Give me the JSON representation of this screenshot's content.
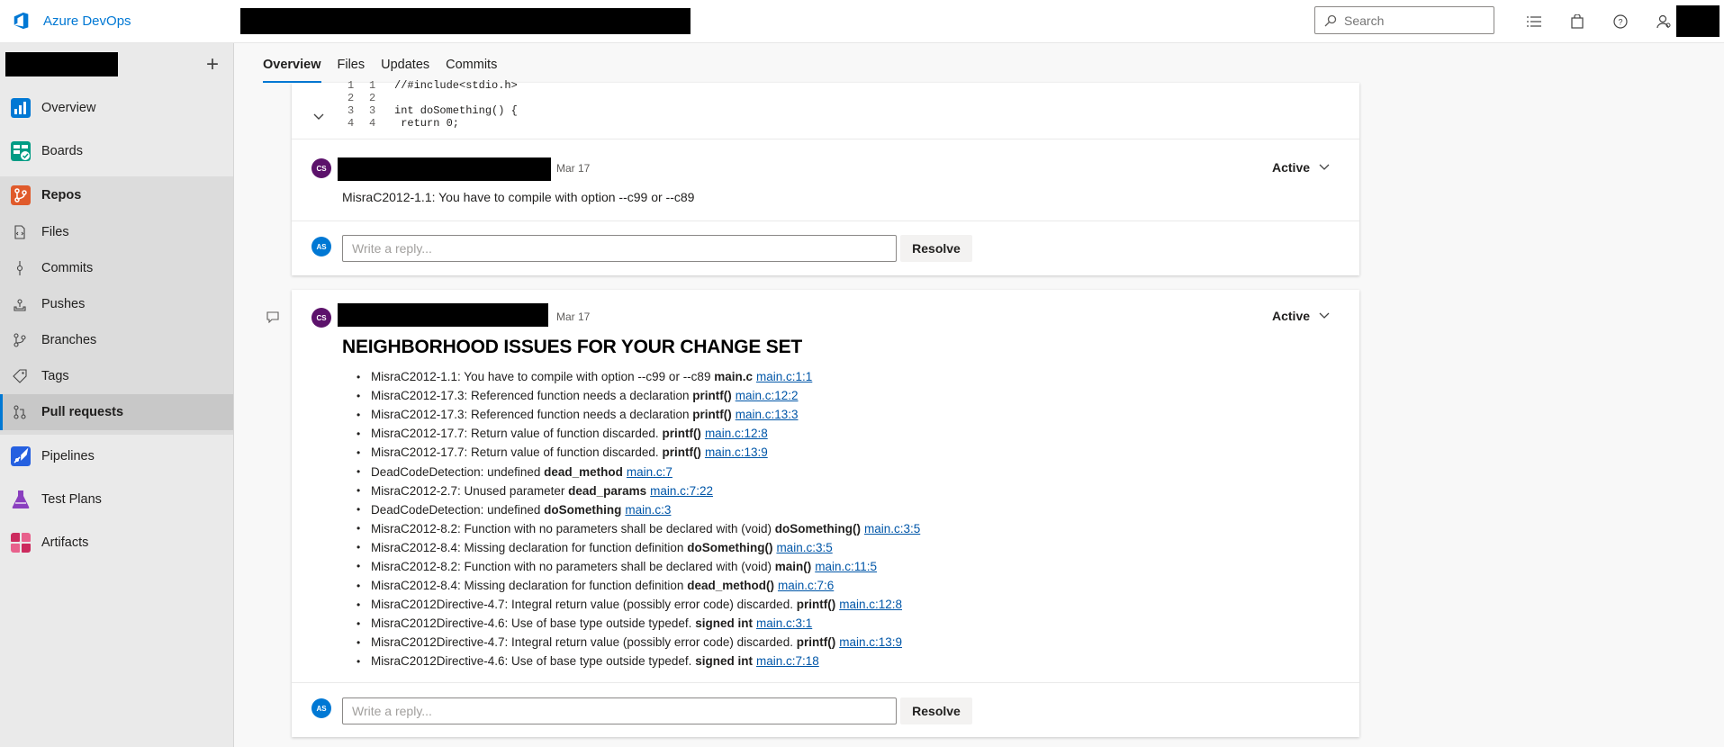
{
  "app": {
    "name": "Azure DevOps"
  },
  "search": {
    "placeholder": "Search"
  },
  "sidebar": {
    "items": [
      {
        "label": "Overview"
      },
      {
        "label": "Boards"
      },
      {
        "label": "Repos"
      },
      {
        "label": "Files"
      },
      {
        "label": "Commits"
      },
      {
        "label": "Pushes"
      },
      {
        "label": "Branches"
      },
      {
        "label": "Tags"
      },
      {
        "label": "Pull requests"
      },
      {
        "label": "Pipelines"
      },
      {
        "label": "Test Plans"
      },
      {
        "label": "Artifacts"
      }
    ]
  },
  "tabs": [
    {
      "label": "Overview"
    },
    {
      "label": "Files"
    },
    {
      "label": "Updates"
    },
    {
      "label": "Commits"
    }
  ],
  "code_snippet": {
    "lines": [
      {
        "old": "1",
        "new": "1",
        "text": "//#include<stdio.h>"
      },
      {
        "old": "2",
        "new": "2",
        "text": ""
      },
      {
        "old": "3",
        "new": "3",
        "text": "int doSomething() {"
      },
      {
        "old": "4",
        "new": "4",
        "text": "  return 0;"
      }
    ]
  },
  "thread1": {
    "avatar": "CS",
    "date": "Mar 17",
    "status": "Active",
    "text": "MisraC2012-1.1: You have to compile with option --c99 or --c89",
    "reply_avatar": "AS",
    "reply_placeholder": "Write a reply...",
    "resolve_label": "Resolve"
  },
  "thread2": {
    "avatar": "CS",
    "date": "Mar 17",
    "status": "Active",
    "title": "NEIGHBORHOOD ISSUES FOR YOUR CHANGE SET",
    "issues": [
      {
        "text": "MisraC2012-1.1: You have to compile with option --c99 or --c89",
        "code": "main.c",
        "link": "main.c:1:1"
      },
      {
        "text": "MisraC2012-17.3: Referenced function needs a declaration",
        "code": "printf()",
        "link": "main.c:12:2"
      },
      {
        "text": "MisraC2012-17.3: Referenced function needs a declaration",
        "code": "printf()",
        "link": "main.c:13:3"
      },
      {
        "text": "MisraC2012-17.7: Return value of function discarded.",
        "code": "printf()",
        "link": "main.c:12:8"
      },
      {
        "text": "MisraC2012-17.7: Return value of function discarded.",
        "code": "printf()",
        "link": "main.c:13:9"
      },
      {
        "text": "DeadCodeDetection: undefined",
        "code": "dead_method",
        "link": "main.c:7"
      },
      {
        "text": "MisraC2012-2.7: Unused parameter",
        "code": "dead_params",
        "link": "main.c:7:22"
      },
      {
        "text": "DeadCodeDetection: undefined",
        "code": "doSomething",
        "link": "main.c:3"
      },
      {
        "text": "MisraC2012-8.2: Function with no parameters shall be declared with (void)",
        "code": "doSomething()",
        "link": "main.c:3:5"
      },
      {
        "text": "MisraC2012-8.4: Missing declaration for function definition",
        "code": "doSomething()",
        "link": "main.c:3:5"
      },
      {
        "text": "MisraC2012-8.2: Function with no parameters shall be declared with (void)",
        "code": "main()",
        "link": "main.c:11:5"
      },
      {
        "text": "MisraC2012-8.4: Missing declaration for function definition",
        "code": "dead_method()",
        "link": "main.c:7:6"
      },
      {
        "text": "MisraC2012Directive-4.7: Integral return value (possibly error code) discarded.",
        "code": "printf()",
        "link": "main.c:12:8"
      },
      {
        "text": "MisraC2012Directive-4.6: Use of base type outside typedef.",
        "code": "signed int",
        "link": "main.c:3:1"
      },
      {
        "text": "MisraC2012Directive-4.7: Integral return value (possibly error code) discarded.",
        "code": "printf()",
        "link": "main.c:13:9"
      },
      {
        "text": "MisraC2012Directive-4.6: Use of base type outside typedef.",
        "code": "signed int",
        "link": "main.c:7:18"
      }
    ],
    "reply_avatar": "AS",
    "reply_placeholder": "Write a reply...",
    "resolve_label": "Resolve"
  },
  "colors": {
    "accent": "#0078d4",
    "avatar_cs": "#5c126b",
    "avatar_as": "#0078d4"
  }
}
